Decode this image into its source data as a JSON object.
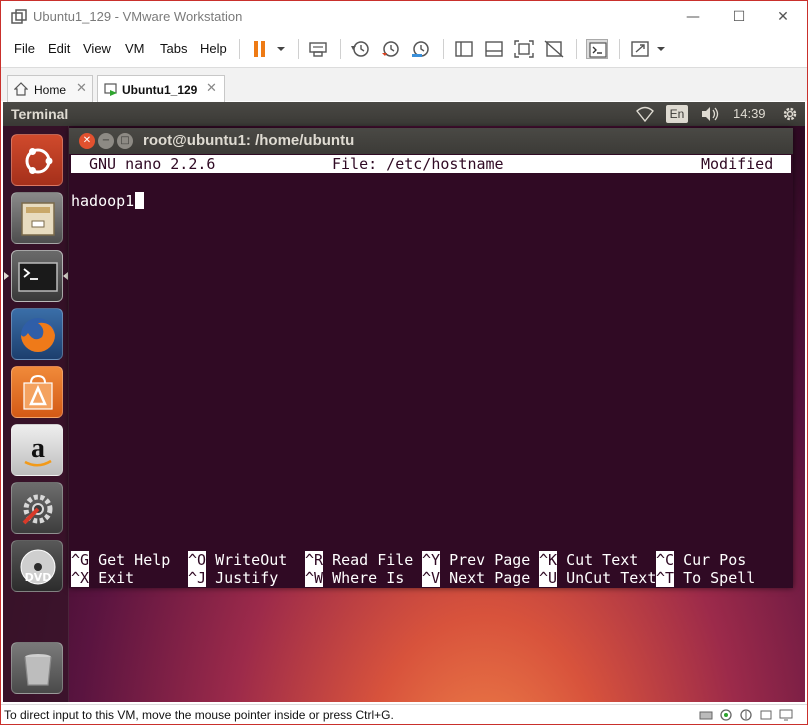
{
  "window": {
    "title": "Ubuntu1_129 - VMware Workstation",
    "minimize_glyph": "—",
    "maximize_glyph": "☐",
    "close_glyph": "✕"
  },
  "menu": {
    "items": [
      "File",
      "Edit",
      "View",
      "VM",
      "Tabs",
      "Help"
    ]
  },
  "toolbar": {
    "icons": [
      "pause-icon",
      "dropdown-arrow-icon",
      "send-ctrl-alt-del-icon",
      "snapshot-take-icon",
      "snapshot-revert-icon",
      "snapshot-manager-icon",
      "library-icon",
      "thumbnail-bar-icon",
      "full-screen-icon",
      "unity-icon",
      "console-view-icon",
      "stretch-guest-icon",
      "dropdown-arrow-icon"
    ],
    "accent": "#ee7a14"
  },
  "tabs": [
    {
      "label": "Home",
      "close": "✕",
      "active": false
    },
    {
      "label": "Ubuntu1_129",
      "close": "✕",
      "active": true
    }
  ],
  "ubuntu_panel": {
    "app_name": "Terminal",
    "keyboard_layout": "En",
    "clock": "14:39",
    "icons": [
      "wifi-icon",
      "volume-icon",
      "settings-gear-icon"
    ]
  },
  "launcher": {
    "items": [
      "ubuntu-dash-icon",
      "files-icon",
      "terminal-icon",
      "firefox-icon",
      "software-center-icon",
      "amazon-icon",
      "system-settings-icon",
      "dvd-icon",
      "trash-icon"
    ],
    "active": "terminal-icon"
  },
  "terminal": {
    "title": "root@ubuntu1: /home/ubuntu",
    "nano": {
      "version": "GNU nano 2.2.6",
      "file": "File: /etc/hostname",
      "status": "Modified",
      "content": "hadoop1",
      "shortcuts_row1": [
        {
          "key": "^G",
          "label": "Get Help"
        },
        {
          "key": "^O",
          "label": "WriteOut"
        },
        {
          "key": "^R",
          "label": "Read File"
        },
        {
          "key": "^Y",
          "label": "Prev Page"
        },
        {
          "key": "^K",
          "label": "Cut Text"
        },
        {
          "key": "^C",
          "label": "Cur Pos"
        }
      ],
      "shortcuts_row2": [
        {
          "key": "^X",
          "label": "Exit"
        },
        {
          "key": "^J",
          "label": "Justify"
        },
        {
          "key": "^W",
          "label": "Where Is"
        },
        {
          "key": "^V",
          "label": "Next Page"
        },
        {
          "key": "^U",
          "label": "UnCut Text"
        },
        {
          "key": "^T",
          "label": "To Spell"
        }
      ]
    }
  },
  "statusbar": {
    "text": "To direct input to this VM, move the mouse pointer inside or press Ctrl+G.",
    "icons": [
      "hard-disk-icon",
      "network-icon",
      "usb-icon",
      "sound-icon",
      "display-icon"
    ]
  }
}
